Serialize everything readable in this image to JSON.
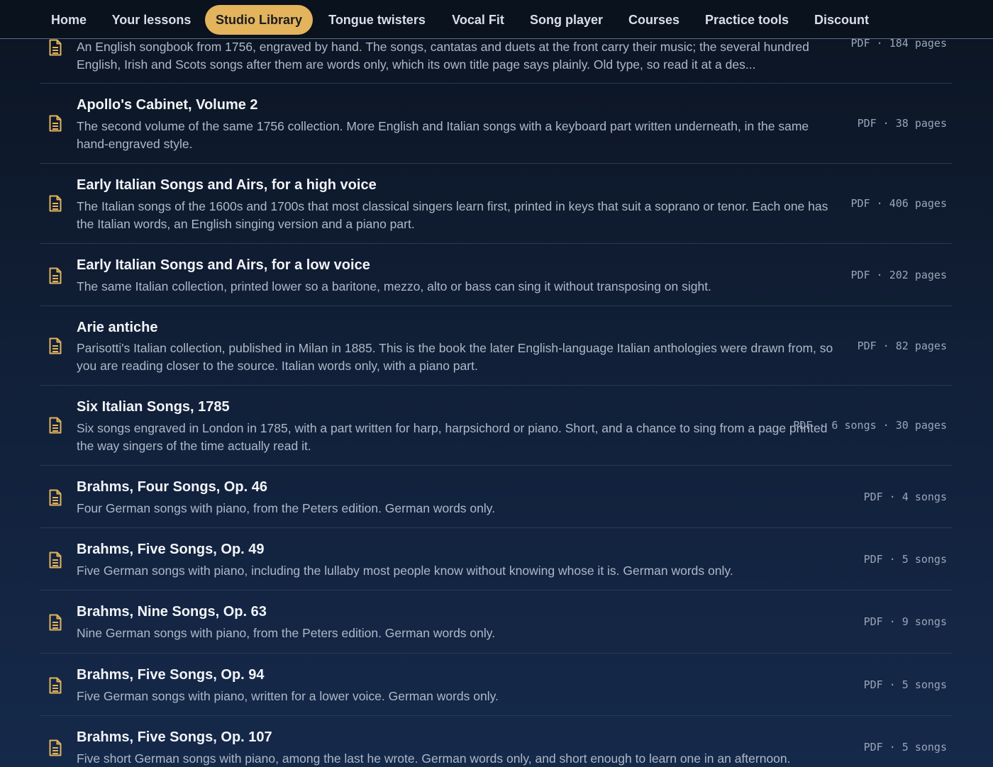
{
  "nav": {
    "items": [
      "Home",
      "Your lessons",
      "Studio Library",
      "Tongue twisters",
      "Vocal Fit",
      "Song player",
      "Courses",
      "Practice tools",
      "Discount"
    ],
    "active": "Studio Library"
  },
  "colors": {
    "accent": "#e3b45c",
    "background": "#111f37"
  },
  "library": {
    "items": [
      {
        "title": "",
        "description": "An English songbook from 1756, engraved by hand. The songs, cantatas and duets at the front carry their music; the several hundred English, Irish and Scots songs after them are words only, which its own title page says plainly. Old type, so read it at a des...",
        "meta": "PDF · 184 pages",
        "icon": "document-icon"
      },
      {
        "title": "Apollo's Cabinet, Volume 2",
        "description": "The second volume of the same 1756 collection. More English and Italian songs with a keyboard part written underneath, in the same hand-engraved style.",
        "meta": "PDF · 38 pages",
        "icon": "document-icon"
      },
      {
        "title": "Early Italian Songs and Airs, for a high voice",
        "description": "The Italian songs of the 1600s and 1700s that most classical singers learn first, printed in keys that suit a soprano or tenor. Each one has the Italian words, an English singing version and a piano part.",
        "meta": "PDF · 406 pages",
        "icon": "document-icon"
      },
      {
        "title": "Early Italian Songs and Airs, for a low voice",
        "description": "The same Italian collection, printed lower so a baritone, mezzo, alto or bass can sing it without transposing on sight.",
        "meta": "PDF · 202 pages",
        "icon": "document-icon"
      },
      {
        "title": "Arie antiche",
        "description": "Parisotti's Italian collection, published in Milan in 1885. This is the book the later English-language Italian anthologies were drawn from, so you are reading closer to the source. Italian words only, with a piano part.",
        "meta": "PDF · 82 pages",
        "icon": "document-icon"
      },
      {
        "title": "Six Italian Songs, 1785",
        "description": "Six songs engraved in London in 1785, with a part written for harp, harpsichord or piano. Short, and a chance to sing from a page printed the way singers of the time actually read it.",
        "meta": "PDF · 6 songs · 30 pages",
        "icon": "document-icon"
      },
      {
        "title": "Brahms, Four Songs, Op. 46",
        "description": "Four German songs with piano, from the Peters edition. German words only.",
        "meta": "PDF · 4 songs",
        "icon": "document-icon"
      },
      {
        "title": "Brahms, Five Songs, Op. 49",
        "description": "Five German songs with piano, including the lullaby most people know without knowing whose it is. German words only.",
        "meta": "PDF · 5 songs",
        "icon": "document-icon"
      },
      {
        "title": "Brahms, Nine Songs, Op. 63",
        "description": "Nine German songs with piano, from the Peters edition. German words only.",
        "meta": "PDF · 9 songs",
        "icon": "document-icon"
      },
      {
        "title": "Brahms, Five Songs, Op. 94",
        "description": "Five German songs with piano, written for a lower voice. German words only.",
        "meta": "PDF · 5 songs",
        "icon": "document-icon"
      },
      {
        "title": "Brahms, Five Songs, Op. 107",
        "description": "Five short German songs with piano, among the last he wrote. German words only, and short enough to learn one in an afternoon.",
        "meta": "PDF · 5 songs",
        "icon": "document-icon"
      }
    ]
  }
}
